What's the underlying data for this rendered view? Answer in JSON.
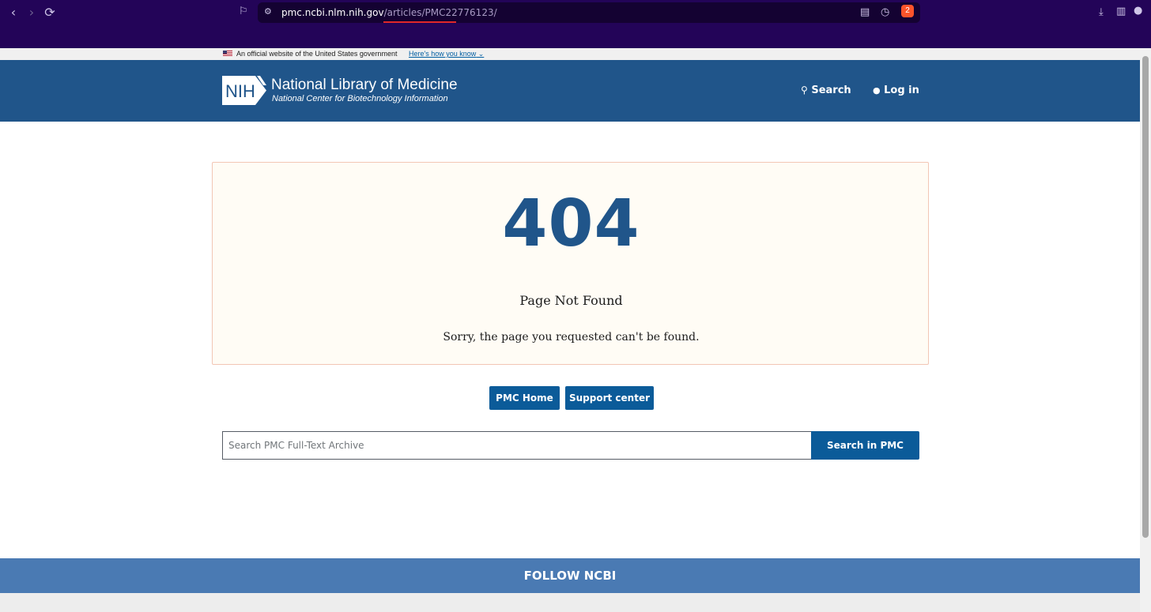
{
  "browser": {
    "url_host": "pmc.ncbi.nlm.nih.gov",
    "url_path": "/articles/PMC22776123/",
    "brave_badge": "2"
  },
  "gov_banner": {
    "text": "An official website of the United States government",
    "link": "Here's how you know"
  },
  "header": {
    "logo_text": "NIH",
    "title": "National Library of Medicine",
    "subtitle": "National Center for Biotechnology Information",
    "search_label": "Search",
    "login_label": "Log in"
  },
  "error": {
    "code": "404",
    "title": "Page Not Found",
    "message": "Sorry, the page you requested can't be found."
  },
  "buttons": {
    "pmc_home": "PMC Home",
    "support_center": "Support center"
  },
  "search": {
    "placeholder": "Search PMC Full-Text Archive",
    "button": "Search in PMC"
  },
  "footer": {
    "follow": "FOLLOW NCBI"
  },
  "colors": {
    "header": "#20558a",
    "button": "#0b5b99",
    "follow_bar": "#4a7ab3",
    "chrome": "#230458"
  }
}
